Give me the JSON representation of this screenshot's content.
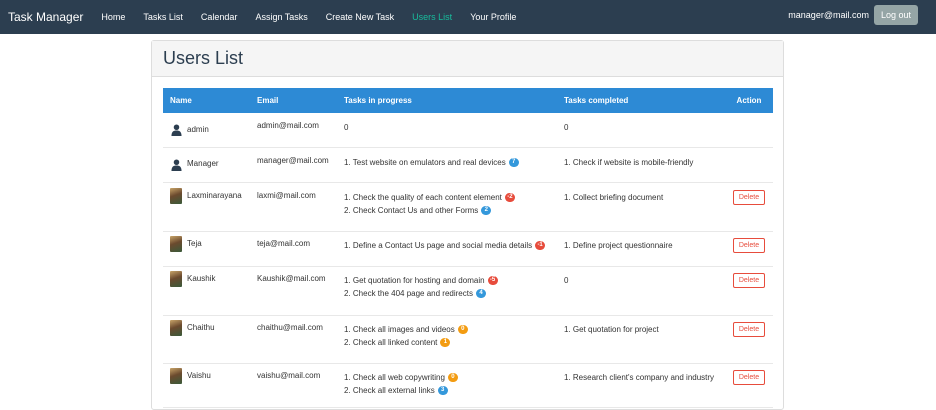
{
  "nav": {
    "brand": "Task Manager",
    "links": [
      "Home",
      "Tasks List",
      "Calendar",
      "Assign Tasks",
      "Create New Task",
      "Users List",
      "Your Profile"
    ],
    "active": "Users List",
    "user_email": "manager@mail.com",
    "logout_label": "Log out"
  },
  "page": {
    "title": "Users List"
  },
  "table": {
    "headers": {
      "name": "Name",
      "email": "Email",
      "in_progress": "Tasks in progress",
      "completed": "Tasks completed",
      "action": "Action"
    },
    "delete_label": "Delete",
    "rows": [
      {
        "name": "admin",
        "avatar": "user-icon",
        "email": "admin@mail.com",
        "in_progress": [
          {
            "text": "0"
          }
        ],
        "completed": [
          {
            "text": "0"
          }
        ],
        "deletable": false
      },
      {
        "name": "Manager",
        "avatar": "user-icon",
        "email": "manager@mail.com",
        "in_progress": [
          {
            "text": "1. Test website on emulators and real devices",
            "badge": "7",
            "color": "blue"
          }
        ],
        "completed": [
          {
            "text": "1. Check if website is mobile-friendly"
          }
        ],
        "deletable": false
      },
      {
        "name": "Laxminarayana",
        "avatar": "photo",
        "email": "laxmi@mail.com",
        "in_progress": [
          {
            "text": "1. Check the quality of each content element",
            "badge": "-2",
            "color": "red"
          },
          {
            "text": "2. Check Contact Us and other Forms",
            "badge": "2",
            "color": "blue"
          }
        ],
        "completed": [
          {
            "text": "1. Collect briefing document"
          }
        ],
        "deletable": true
      },
      {
        "name": "Teja",
        "avatar": "photo",
        "email": "teja@mail.com",
        "in_progress": [
          {
            "text": "1. Define a Contact Us page and social media details",
            "badge": "-1",
            "color": "red"
          }
        ],
        "completed": [
          {
            "text": "1. Define project questionnaire"
          }
        ],
        "deletable": true
      },
      {
        "name": "Kaushik",
        "avatar": "photo",
        "email": "Kaushik@mail.com",
        "in_progress": [
          {
            "text": "1. Get quotation for hosting and domain",
            "badge": "-5",
            "color": "red"
          },
          {
            "text": "2. Check the 404 page and redirects",
            "badge": "4",
            "color": "blue"
          }
        ],
        "completed": [
          {
            "text": "0"
          }
        ],
        "deletable": true
      },
      {
        "name": "Chaithu",
        "avatar": "photo",
        "email": "chaithu@mail.com",
        "in_progress": [
          {
            "text": "1. Check all images and videos",
            "badge": "0",
            "color": "orange"
          },
          {
            "text": "2. Check all linked content",
            "badge": "1",
            "color": "orange"
          }
        ],
        "completed": [
          {
            "text": "1. Get quotation for project"
          }
        ],
        "deletable": true
      },
      {
        "name": "Vaishu",
        "avatar": "photo",
        "email": "vaishu@mail.com",
        "in_progress": [
          {
            "text": "1. Check all web copywriting",
            "badge": "0",
            "color": "orange"
          },
          {
            "text": "2. Check all external links",
            "badge": "3",
            "color": "blue"
          }
        ],
        "completed": [
          {
            "text": "1. Research client's company and industry"
          }
        ],
        "deletable": true
      }
    ]
  },
  "colors": {
    "navbar": "#2c3e50",
    "active_link": "#18bc9c",
    "table_header": "#2d8ad5",
    "badge_blue": "#3498db",
    "badge_red": "#e74c3c",
    "badge_orange": "#f39c12",
    "delete": "#e74c3c"
  }
}
